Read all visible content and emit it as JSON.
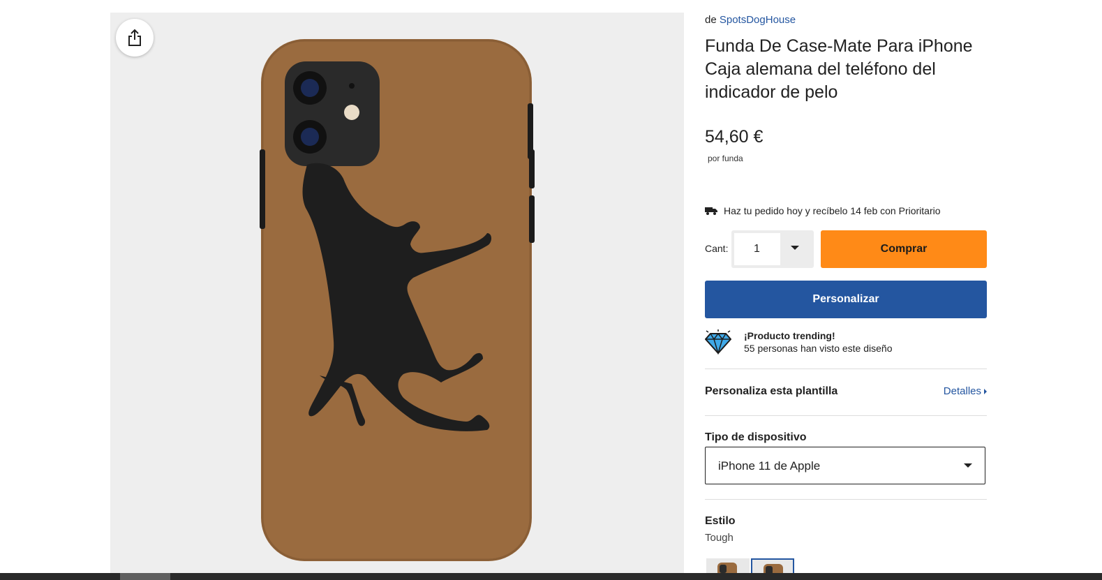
{
  "product": {
    "by_prefix": "de",
    "seller": "SpotsDogHouse",
    "title": "Funda De Case-Mate Para iPhone Caja alemana del teléfono del indicador de pelo",
    "price": "54,60 €",
    "price_unit": "por funda",
    "image_colors": {
      "case": "#9a6b3f",
      "dog": "#1e1e1e",
      "background": "#eeeeee"
    }
  },
  "shipping": {
    "icon": "truck-icon",
    "text": "Haz tu pedido hoy y recíbelo 14 feb con Prioritario"
  },
  "quantity": {
    "label": "Cant:",
    "value": "1"
  },
  "buttons": {
    "buy": "Comprar",
    "customize": "Personalizar",
    "share_icon": "share-icon"
  },
  "trending": {
    "icon": "diamond-icon",
    "title": "¡Producto trending!",
    "subtitle": "55 personas han visto este diseño"
  },
  "template": {
    "label": "Personaliza esta plantilla",
    "details_link": "Detalles"
  },
  "device": {
    "label": "Tipo de dispositivo",
    "selected": "iPhone 11 de Apple"
  },
  "style": {
    "label": "Estilo",
    "selected": "Tough"
  },
  "colors": {
    "accent_orange": "#ff8a17",
    "accent_blue": "#2456a0"
  }
}
